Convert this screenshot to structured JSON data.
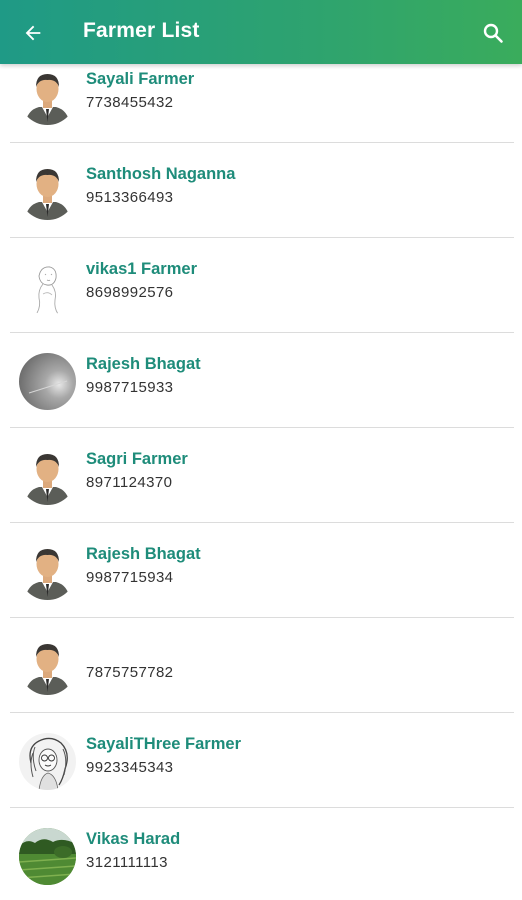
{
  "header": {
    "title": "Farmer List",
    "back_icon": "arrow-left-icon",
    "search_icon": "search-icon",
    "background_start": "#1f9a86",
    "background_end": "#3aac5c"
  },
  "accent_name_color": "#1e8c7a",
  "farmers": [
    {
      "name": "Sayali Farmer",
      "phone": "7738455432",
      "avatar": "default-person-avatar"
    },
    {
      "name": "Santhosh Naganna",
      "phone": "9513366493",
      "avatar": "default-person-avatar"
    },
    {
      "name": "vikas1 Farmer",
      "phone": "8698992576",
      "avatar": "sketch-avatar"
    },
    {
      "name": "Rajesh Bhagat",
      "phone": "9987715933",
      "avatar": "gray-photo-avatar"
    },
    {
      "name": "Sagri Farmer",
      "phone": "8971124370",
      "avatar": "default-person-avatar"
    },
    {
      "name": "Rajesh Bhagat",
      "phone": "9987715934",
      "avatar": "default-person-avatar"
    },
    {
      "name": "",
      "phone": "7875757782",
      "avatar": "default-person-avatar"
    },
    {
      "name": "SayaliTHree Farmer",
      "phone": "9923345343",
      "avatar": "drawing-avatar"
    },
    {
      "name": "Vikas Harad",
      "phone": "3121111113",
      "avatar": "landscape-photo-avatar"
    }
  ]
}
